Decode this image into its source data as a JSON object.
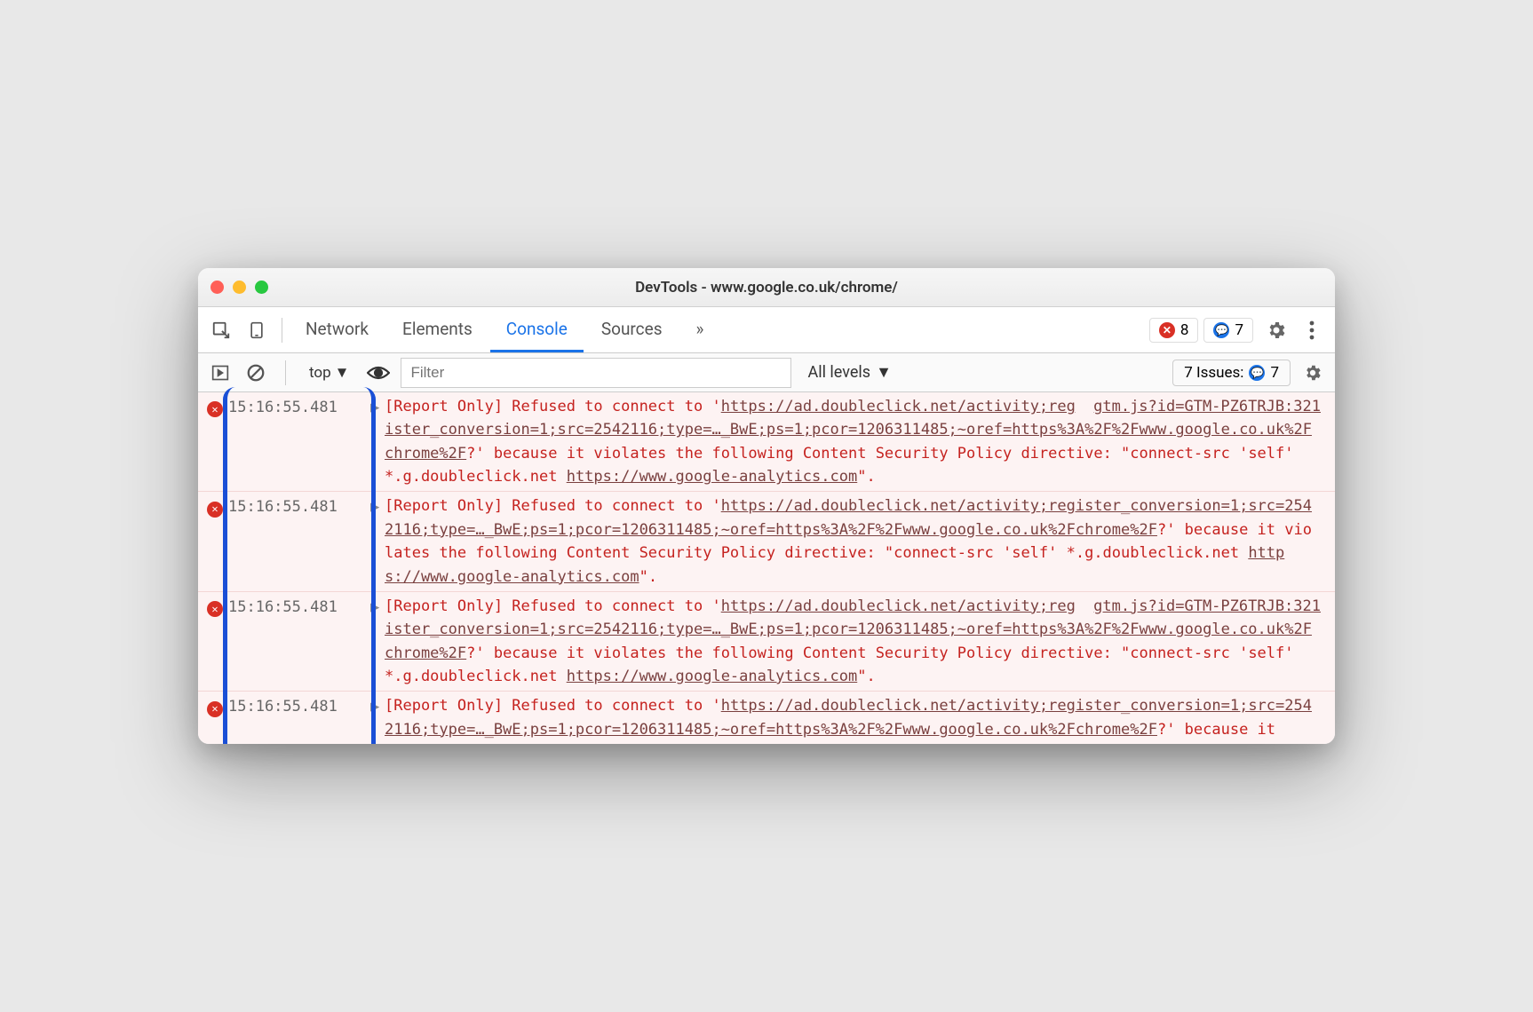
{
  "window": {
    "title": "DevTools - www.google.co.uk/chrome/"
  },
  "tabs": {
    "network": "Network",
    "elements": "Elements",
    "console": "Console",
    "sources": "Sources",
    "more": "»"
  },
  "counters": {
    "errors": "8",
    "messages": "7"
  },
  "subbar": {
    "context": "top",
    "filter_placeholder": "Filter",
    "levels": "All levels",
    "issues_label": "7 Issues:",
    "issues_count": "7"
  },
  "timestamps": [
    "15:16:55.481",
    "15:16:55.481",
    "15:16:55.481",
    "15:16:55.481"
  ],
  "source_link": "gtm.js?id=GTM-PZ6TRJB:321",
  "msg1": {
    "p1": "[Report Only] Refused to connect to '",
    "u1": "http",
    "u2": "s://ad.doubleclick.net/activity;register_conversion=1;src=2542116;type=…_BwE;ps=1;pcor=1206311485;~oref=https%3A%2F%2Fwww.google.co.uk%2Fchrome%2F",
    "p2": "?' because it violates the following Content Security Policy directive: \"connect-src 'self' *.g.doubleclick.net ",
    "u3": "https://www.google-analytics.com",
    "p3": "\"."
  },
  "msg2": {
    "p1": "[Report Only] Refused to connect to '",
    "u1": "https://ad.doubleclick.net/activity;register_conversion=1;src=2542116;type=…_BwE;ps=1;pcor=1206311485;~oref=https%3A%2F%2Fwww.google.co.uk%2Fchrome%2F",
    "p2": "?' because it violates the following Content Security Policy directive: \"connect-src 'self' *.g.doubleclick.net ",
    "u2": "https://www.google-analytics.com",
    "p3": "\"."
  },
  "msg4_partial": "?' because it"
}
